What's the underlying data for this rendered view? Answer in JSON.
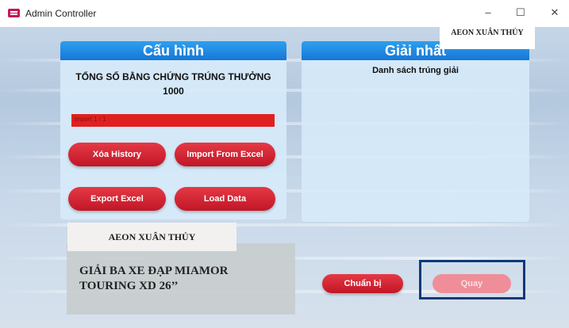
{
  "window": {
    "title": "Admin Controller",
    "minimize": "–",
    "maximize": "☐",
    "close": "✕"
  },
  "config_panel": {
    "title": "Cấu hình",
    "stat_label": "TỔNG SỐ BẰNG CHỨNG TRÚNG THƯỞNG",
    "stat_value": "1000",
    "progress_text": "Import 1 / 1",
    "progress_fraction": 1.0,
    "buttons": {
      "clear_history": "Xóa History",
      "import_excel": "Import From Excel",
      "export_excel": "Export Excel",
      "load_data": "Load Data"
    }
  },
  "store_name": "AEON XUÂN THỦY",
  "prize_text": "GIẢI BA XE ĐẠP MIAMOR TOURING XD 26’’",
  "prize_panel": {
    "title": "Giải nhất",
    "list_title": "Danh sách trúng giải",
    "store_overlay": "AEON XUÂN THỦY"
  },
  "actions": {
    "prepare": "Chuẩn bị",
    "spin": "Quay"
  },
  "colors": {
    "accent": "#1677d6",
    "button_red": "#d0202e",
    "spin_disabled": "#ef8e99",
    "frame": "#0b3a78"
  }
}
